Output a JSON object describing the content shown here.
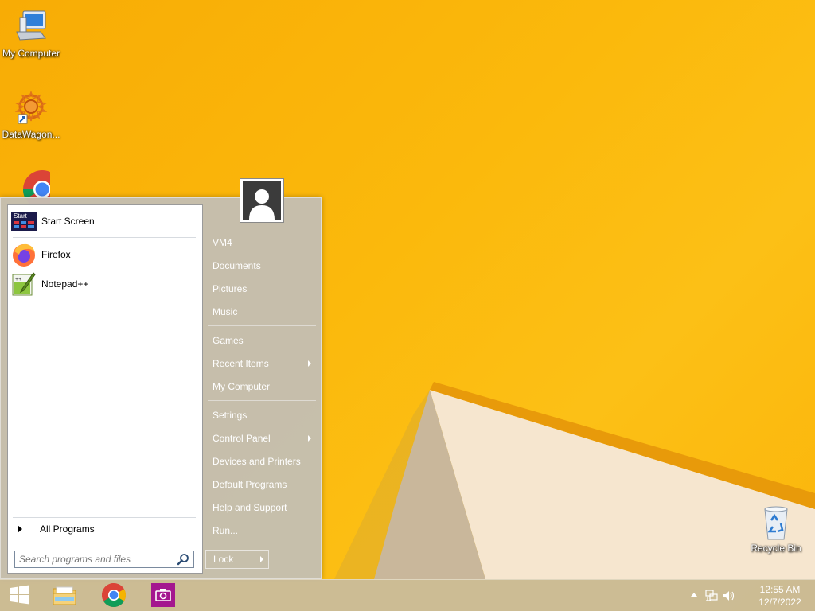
{
  "desktop": {
    "icons": [
      {
        "label": "My Computer",
        "icon": "computer-icon"
      },
      {
        "label": "DataWagon...",
        "icon": "datawagon-icon"
      },
      {
        "label": "Google Chrome",
        "icon": "chrome-icon"
      },
      {
        "label": "Recycle Bin",
        "icon": "recycle-bin-icon"
      }
    ]
  },
  "start_menu": {
    "pinned": [
      {
        "label": "Start Screen",
        "icon": "start-screen-icon"
      },
      {
        "label": "Firefox",
        "icon": "firefox-icon"
      },
      {
        "label": "Notepad++",
        "icon": "notepadpp-icon"
      }
    ],
    "start_badge": "Start",
    "all_programs": "All Programs",
    "search_placeholder": "Search programs and files",
    "right_items": [
      {
        "label": "VM4"
      },
      {
        "label": "Documents"
      },
      {
        "label": "Pictures"
      },
      {
        "label": "Music"
      },
      {
        "label": "Games"
      },
      {
        "label": "Recent Items",
        "submenu": true
      },
      {
        "label": "My Computer"
      },
      {
        "label": "Settings"
      },
      {
        "label": "Control Panel",
        "submenu": true
      },
      {
        "label": "Devices and Printers"
      },
      {
        "label": "Default Programs"
      },
      {
        "label": "Help and Support"
      },
      {
        "label": "Run..."
      }
    ],
    "lock_label": "Lock"
  },
  "taskbar": {
    "apps": [
      {
        "name": "start-button",
        "icon": "windows-logo-icon"
      },
      {
        "name": "file-explorer",
        "icon": "folder-icon"
      },
      {
        "name": "chrome",
        "icon": "chrome-icon"
      },
      {
        "name": "camera-app",
        "icon": "camera-icon"
      }
    ],
    "time": "12:55 AM",
    "date": "12/7/2022"
  },
  "colors": {
    "wallpaper": "#fbb90c",
    "menu_bg": "#c4beb2",
    "taskbar_bg": "#c8bca0"
  }
}
